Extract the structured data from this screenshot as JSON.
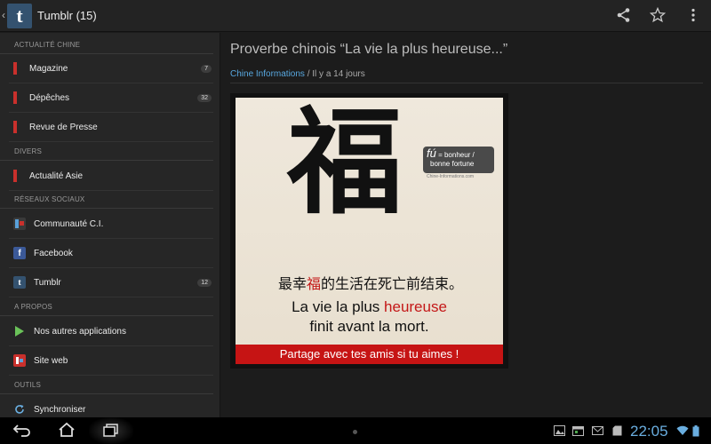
{
  "actionbar": {
    "up_caret": "‹",
    "logo_letter": "t",
    "title": "Tumblr (15)",
    "icons": [
      "share-icon",
      "star-icon",
      "overflow-menu-icon"
    ]
  },
  "sidebar": {
    "sections": [
      {
        "header": "ACTUALITÉ CHINE"
      },
      {
        "header": "DIVERS"
      },
      {
        "header": "RÉSEAUX SOCIAUX"
      },
      {
        "header": "A PROPOS"
      },
      {
        "header": "OUTILS"
      }
    ],
    "items": [
      {
        "label": "Magazine",
        "badge": "7"
      },
      {
        "label": "Dépêches",
        "badge": "32"
      },
      {
        "label": "Revue de Presse",
        "badge": ""
      },
      {
        "label": "Actualité Asie",
        "badge": ""
      },
      {
        "label": "Communauté C.I.",
        "badge": ""
      },
      {
        "label": "Facebook",
        "badge": ""
      },
      {
        "label": "Tumblr",
        "badge": "12"
      },
      {
        "label": "Nos autres applications",
        "badge": ""
      },
      {
        "label": "Site web",
        "badge": ""
      },
      {
        "label": "Synchroniser",
        "badge": ""
      }
    ],
    "icon_letters": {
      "facebook": "f",
      "tumblr": "t"
    }
  },
  "article": {
    "title": "Proverbe chinois “La vie la plus heureuse...”",
    "source": "Chine Informations",
    "separator": " / ",
    "age": "Il y a 14 jours",
    "image": {
      "big_char": "福",
      "tag_fu": "fú",
      "tag_line1": "= bonheur /",
      "tag_line2": "bonne fortune",
      "tag_site": "Chine-Informations.com",
      "zh_pre": "最幸",
      "zh_hl": "福",
      "zh_post": "的生活在死亡前结束。",
      "fr1_pre": "La vie la plus ",
      "fr1_hl": "heureuse",
      "fr2": "finit avant la mort.",
      "banner": "Partage avec tes amis si tu aimes !"
    }
  },
  "sysbar": {
    "clock": "22:05"
  },
  "colors": {
    "accent_red": "#c9302c",
    "link_blue": "#58a8e0",
    "clock_blue": "#6aaee0"
  }
}
